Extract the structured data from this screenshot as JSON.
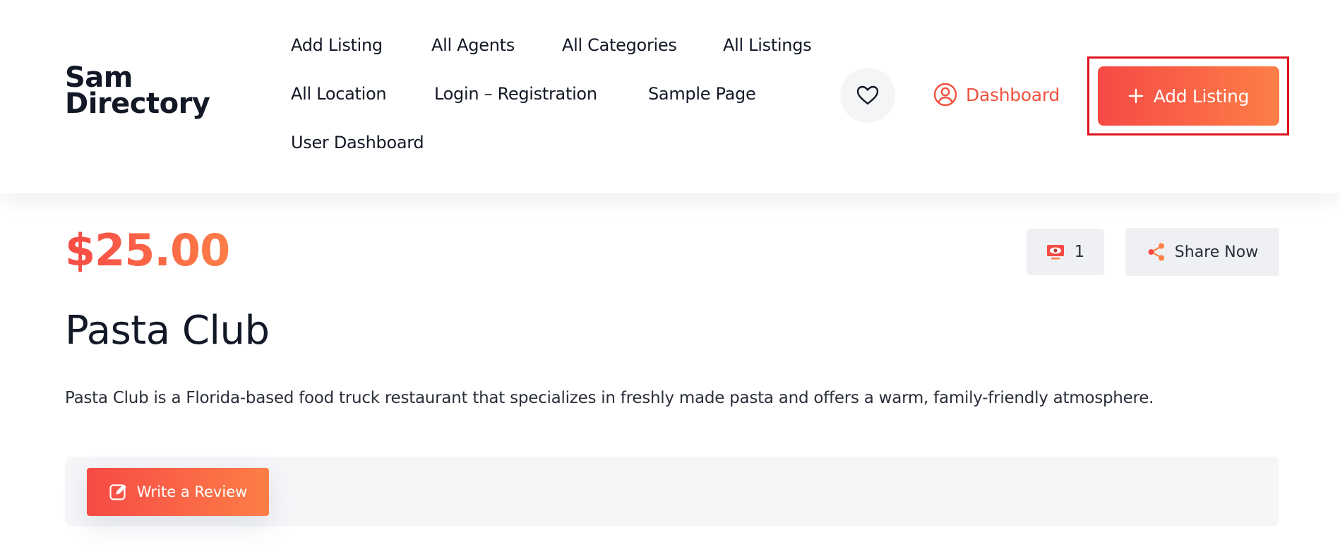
{
  "brand": {
    "line1": "Sam",
    "line2": "Directory"
  },
  "nav": {
    "items": [
      {
        "label": "Add Listing"
      },
      {
        "label": "All Agents"
      },
      {
        "label": "All Categories"
      },
      {
        "label": "All Listings"
      },
      {
        "label": "All Location"
      },
      {
        "label": "Login – Registration"
      },
      {
        "label": "Sample Page"
      },
      {
        "label": "User Dashboard"
      }
    ]
  },
  "header": {
    "wishlist_icon": "heart-icon",
    "dashboard_label": "Dashboard",
    "dashboard_icon": "user-circle-icon",
    "add_listing_label": "Add Listing",
    "add_listing_icon": "plus-icon"
  },
  "listing": {
    "price": "$25.00",
    "views_count": "1",
    "views_icon": "eye-monitor-icon",
    "share_label": "Share Now",
    "share_icon": "share-icon",
    "title": "Pasta Club",
    "description": "Pasta Club is a Florida-based food truck restaurant that specializes in freshly made pasta and offers a warm, family-friendly atmosphere.",
    "review_label": "Write a Review",
    "review_icon": "edit-icon"
  },
  "colors": {
    "accent_start": "#f64a45",
    "accent_end": "#fd7e47",
    "text_dark": "#121826",
    "highlight_frame": "#e0131f"
  }
}
